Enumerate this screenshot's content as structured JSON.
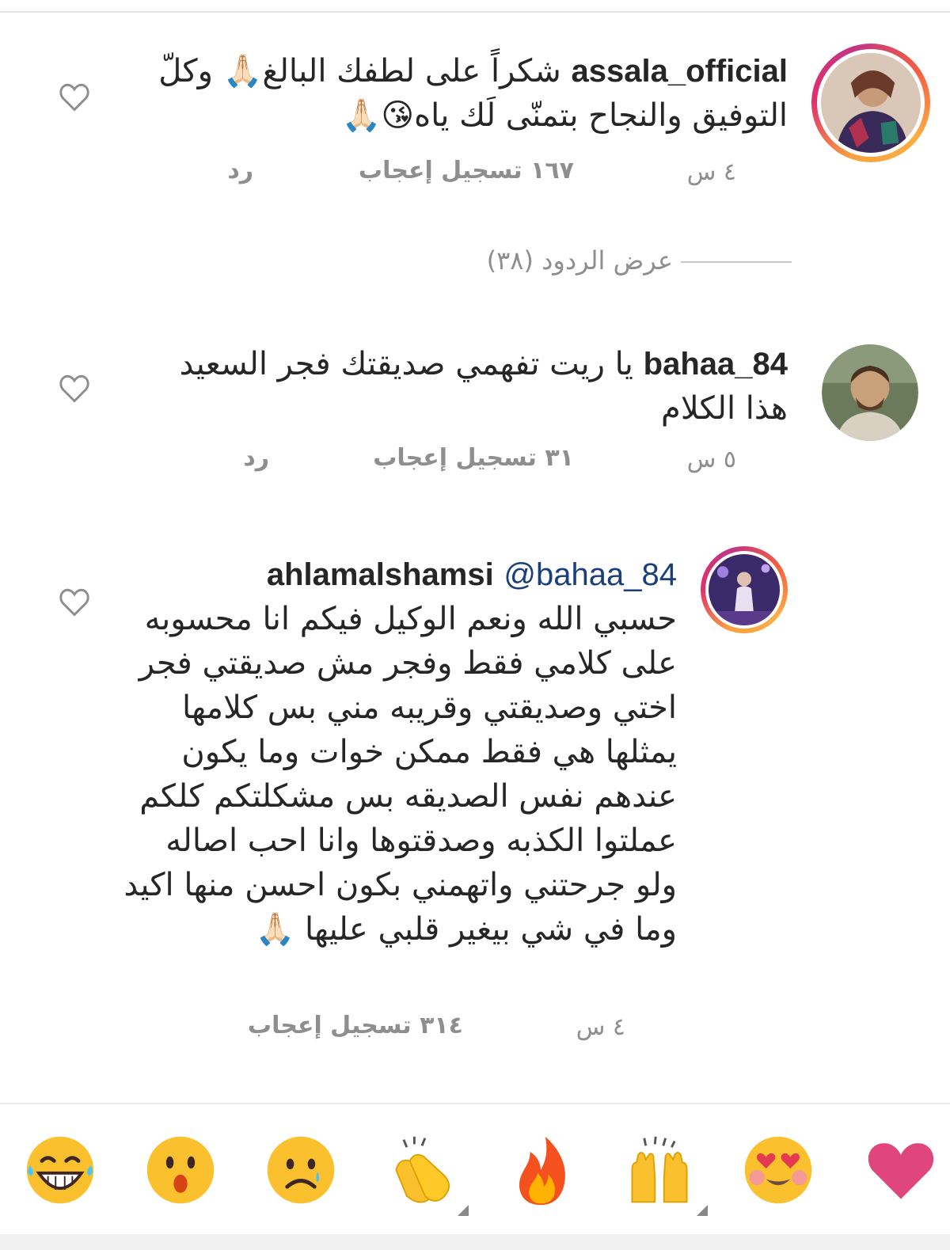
{
  "comments": [
    {
      "username": "assala_official",
      "text": "شكراً على لطفك البالغ🙏🏻 وكلّ التوفيق والنجاح بتمنّى لَك ياه😘🙏🏻",
      "time": "٤ س",
      "likes": "١٦٧ تسجيل إعجاب",
      "reply": "رد"
    },
    {
      "username": "bahaa_84",
      "text": "يا ريت تفهمي صديقتك فجر السعيد هذا الكلام",
      "time": "٥ س",
      "likes": "٣١ تسجيل إعجاب",
      "reply": "رد"
    },
    {
      "username": "ahlamalshamsi",
      "mention": "@bahaa_84",
      "text": "حسبي الله ونعم الوكيل فيكم انا محسوبه على كلامي فقط وفجر مش صديقتي فجر اختي وصديقتي وقريبه مني بس كلامها يمثلها هي فقط ممكن خوات وما يكون عندهم نفس الصديقه بس مشكلتكم كلكم عملتوا الكذبه وصدقتوها وانا احب اصاله ولو جرحتني واتهمني بكون احسن منها اكيد وما في شي بيغير قلبي عليها 🙏🏻",
      "time": "٤ س",
      "likes": "٣١٤ تسجيل إعجاب"
    }
  ],
  "view_replies": "عرض الردود (٣٨)",
  "emoji_bar": [
    "heart-icon",
    "heart-eyes-icon",
    "raised-hands-icon",
    "fire-icon",
    "clapping-hands-icon",
    "sad-face-icon",
    "surprised-face-icon",
    "laughing-face-icon"
  ],
  "colors": {
    "text": "#262626",
    "muted": "#8e8e8e",
    "mention": "#1a3f7a",
    "heart": "#e0457b"
  }
}
